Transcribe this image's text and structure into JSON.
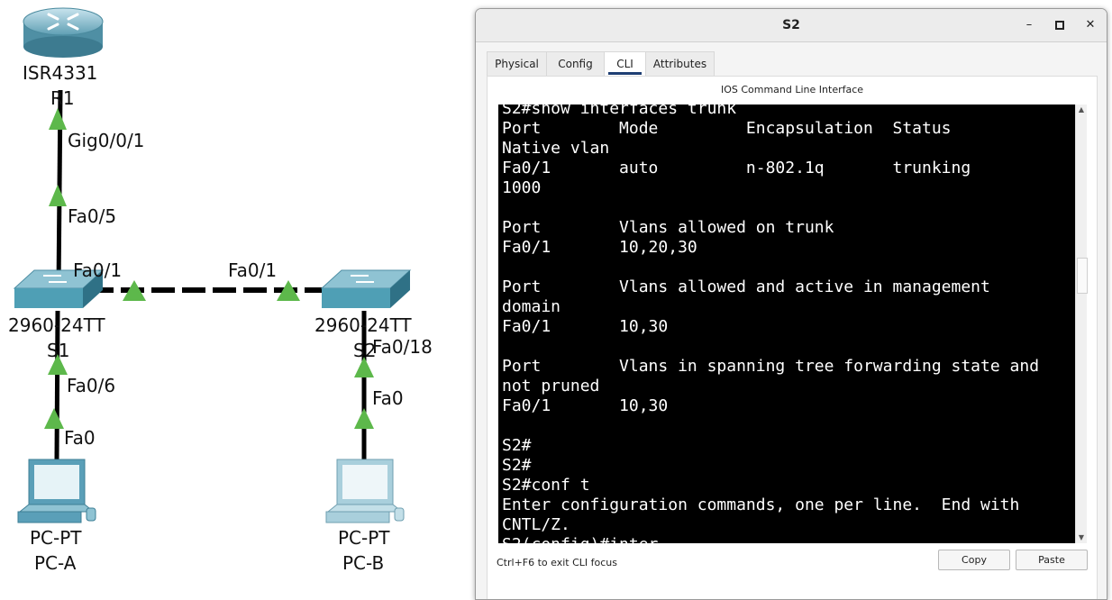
{
  "topology": {
    "router": {
      "model": "ISR4331",
      "name": "R1",
      "port": "Gig0/0/1"
    },
    "switch1": {
      "model": "2960-24TT",
      "name": "S1",
      "uplink_port": "Fa0/5",
      "trunk_port": "Fa0/1",
      "access_port": "Fa0/6"
    },
    "switch2": {
      "model": "2960-24TT",
      "name": "S2",
      "trunk_port": "Fa0/1",
      "access_port": "Fa0/18"
    },
    "pc_a": {
      "model": "PC-PT",
      "name": "PC-A",
      "port": "Fa0"
    },
    "pc_b": {
      "model": "PC-PT",
      "name": "PC-B",
      "port": "Fa0"
    },
    "colors": {
      "link": "#000000",
      "link_status": "#5db84b",
      "device_blue": "#4f9fb5"
    }
  },
  "window": {
    "title": "S2",
    "controls": {
      "minimize": "–",
      "maximize": "□",
      "close": "✕"
    },
    "tabs": [
      {
        "label": "Physical"
      },
      {
        "label": "Config"
      },
      {
        "label": "CLI"
      },
      {
        "label": "Attributes"
      }
    ],
    "active_tab": "CLI",
    "panel_title": "IOS Command Line Interface",
    "terminal_lines": [
      "S2#show interfaces trunk",
      "Port        Mode         Encapsulation  Status",
      "Native vlan",
      "Fa0/1       auto         n-802.1q       trunking",
      "1000",
      "",
      "Port        Vlans allowed on trunk",
      "Fa0/1       10,20,30",
      "",
      "Port        Vlans allowed and active in management",
      "domain",
      "Fa0/1       10,30",
      "",
      "Port        Vlans in spanning tree forwarding state and",
      "not pruned",
      "Fa0/1       10,30",
      "",
      "S2#",
      "S2#",
      "S2#conf t",
      "Enter configuration commands, one per line.  End with",
      "CNTL/Z.",
      "S2(config)#inter"
    ],
    "hint": "Ctrl+F6 to exit CLI focus",
    "copy_label": "Copy",
    "paste_label": "Paste"
  }
}
